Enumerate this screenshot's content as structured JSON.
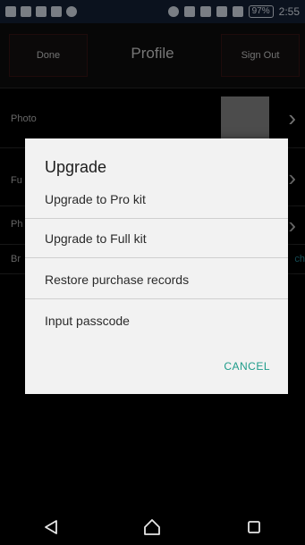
{
  "status_bar": {
    "battery": "97%",
    "time": "2:55"
  },
  "header": {
    "left_button": "Done",
    "title": "Profile",
    "right_button": "Sign Out"
  },
  "profile_rows": {
    "photo_label": "Photo",
    "row_a_label": "Fu",
    "row_b_label": "Ph",
    "row_c_label": "Br",
    "row_c_tail": "ch"
  },
  "dialog": {
    "title": "Upgrade",
    "options": [
      "Upgrade to Pro kit",
      "Upgrade to Full kit",
      "Restore purchase records",
      "Input passcode"
    ],
    "cancel_label": "CANCEL"
  },
  "colors": {
    "accent": "#1e9c8a",
    "status_bar_bg": "#152238"
  },
  "icons": {
    "back": "back-triangle-icon",
    "home": "home-icon",
    "recents": "recents-square-icon"
  }
}
